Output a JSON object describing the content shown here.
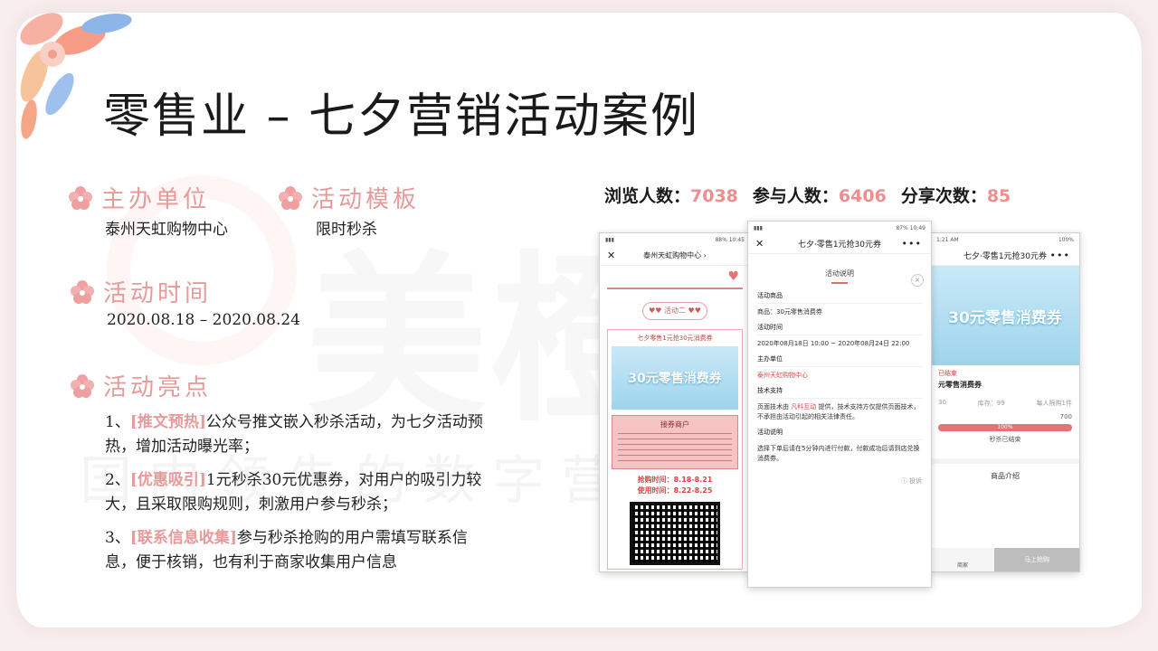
{
  "title": "零售业 – 七夕营销活动案例",
  "watermark": {
    "logo": "美橙互联",
    "text": "国内领先的数字营销服务商"
  },
  "sections": {
    "organizer": {
      "heading": "主办单位",
      "value": "泰州天虹购物中心"
    },
    "template": {
      "heading": "活动模板",
      "value": "限时秒杀"
    },
    "time": {
      "heading": "活动时间",
      "value": "2020.08.18 – 2020.08.24"
    },
    "highlights": {
      "heading": "活动亮点",
      "items": [
        {
          "prefix": "1、",
          "tag": "[推文预热]",
          "text": "公众号推文嵌入秒杀活动，为七夕活动预热，增加活动曝光率；"
        },
        {
          "prefix": "2、",
          "tag": "[优惠吸引]",
          "text": "1元秒杀30元优惠券，对用户的吸引力较大，且采取限购规则，刺激用户参与秒杀；"
        },
        {
          "prefix": "3、",
          "tag": "[联系信息收集]",
          "text": "参与秒杀抢购的用户需填写联系信息，便于核销，也有利于商家收集用户信息"
        }
      ]
    }
  },
  "stats": {
    "views_label": "浏览人数：",
    "views": "7038",
    "participants_label": "参与人数：",
    "participants": "6406",
    "shares_label": "分享次数：",
    "shares": "85"
  },
  "phone_left": {
    "status_right": "88% 10:45",
    "nav_title": "泰州天虹购物中心 ›",
    "tab": "♥♥ 活动二 ♥♥",
    "frame_title": "七夕零售1元抢30元消费券",
    "banner": "30元零售消费券",
    "merchant_title": "接券商户",
    "time1": "抢购时间：8.18-8.21",
    "time2": "使用时间：8.22-8.25"
  },
  "phone_middle": {
    "status_right": "87% 10:49",
    "nav_title": "七夕·零售1元抢30元券",
    "head": "活动说明",
    "close": "×",
    "goods_label": "活动商品",
    "goods_value": "商品：30元零售消费券",
    "time_label": "活动时间",
    "time_value": "2020年08月18日 10:00 ~ 2020年08月24日 22:00",
    "org_label": "主办单位",
    "org_value": "泰州天虹购物中心",
    "tech_label": "技术支持",
    "tech_prefix": "页面技术由 ",
    "tech_name": "凡科互动",
    "tech_suffix": " 提供，技术支持方仅提供页面技术，不承担由活动引起的相关法律责任。",
    "desc_label": "活动说明",
    "desc_value": "选择下单后请在5分钟内进行付款，付款成功后请到店兑换消费券。",
    "report": "ⓘ 投诉"
  },
  "phone_right": {
    "status_left": "1:21 AM",
    "status_right": "100%",
    "nav_title": "七夕·零售1元抢30元券",
    "banner": "30元零售消费券",
    "tag": "已结束",
    "name": "元零售消费券",
    "col1": "30",
    "col2": "库存：99",
    "col3": "每人限购1件",
    "count": "700",
    "bar": "100%",
    "ended": "秒杀已结束",
    "intro": "商品介绍",
    "merchant": "商家",
    "buy": "马上抢购"
  }
}
